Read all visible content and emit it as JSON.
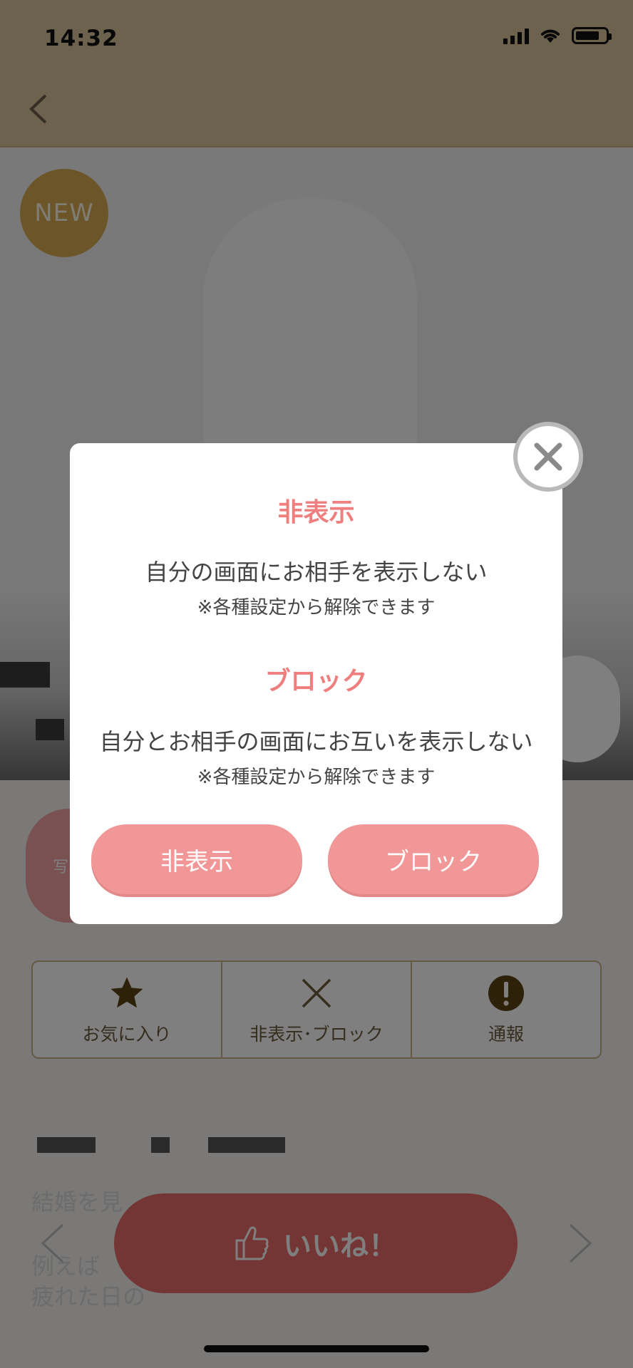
{
  "status_bar": {
    "time": "14:32"
  },
  "profile": {
    "badge": "NEW",
    "photo_button_label": "写真",
    "blurred_text_1": "結婚を見",
    "blurred_text_2": "例えば",
    "blurred_text_3": "疲れた日の"
  },
  "actions": [
    {
      "label": "お気に入り",
      "icon": "star-icon"
    },
    {
      "label": "非表示･ブロック",
      "icon": "x-icon"
    },
    {
      "label": "通報",
      "icon": "alert-icon"
    }
  ],
  "like_button": {
    "label": "いいね！",
    "icon": "thumbs-up-icon"
  },
  "modal": {
    "hide_title": "非表示",
    "hide_desc": "自分の画面にお相手を表示しない",
    "hide_note": "※各種設定から解除できます",
    "block_title": "ブロック",
    "block_desc": "自分とお相手の画面にお互いを表示しない",
    "block_note": "※各種設定から解除できます",
    "hide_button": "非表示",
    "block_button": "ブロック"
  },
  "colors": {
    "header_bg": "#d9c59b",
    "accent_pink": "#f19797",
    "title_pink": "#ef7f7f",
    "like_red": "#e96a6a",
    "badge_gold": "#d8ad52",
    "action_brown": "#6a5a3c"
  }
}
